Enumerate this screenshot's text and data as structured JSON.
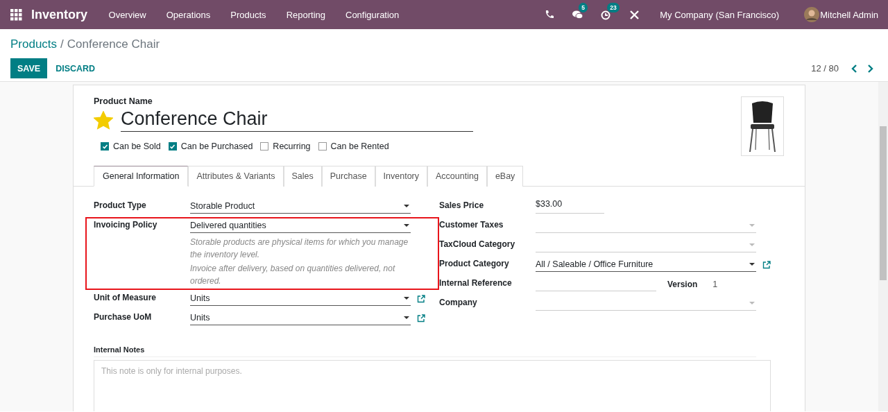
{
  "navbar": {
    "app_name": "Inventory",
    "menu": [
      "Overview",
      "Operations",
      "Products",
      "Reporting",
      "Configuration"
    ],
    "notifications": [
      {
        "kind": "phone"
      },
      {
        "kind": "messages",
        "count": "5"
      },
      {
        "kind": "activities",
        "count": "23"
      },
      {
        "kind": "debug"
      }
    ],
    "company": "My Company (San Francisco)",
    "user": "Mitchell Admin"
  },
  "breadcrumb": {
    "parent": "Products",
    "separator": "/",
    "current": "Conference Chair"
  },
  "buttons": [
    {
      "label": "SAVE",
      "kind": "primary"
    },
    {
      "label": "DISCARD",
      "kind": "link"
    }
  ],
  "pager": "12 / 80",
  "form": {
    "name_label": "Product Name",
    "name": "Conference Chair",
    "favorite": true,
    "options": [
      {
        "label": "Can be Sold",
        "checked": true
      },
      {
        "label": "Can be Purchased",
        "checked": true
      },
      {
        "label": "Recurring",
        "checked": false
      },
      {
        "label": "Can be Rented",
        "checked": false
      }
    ],
    "tabs": [
      {
        "label": "General Information",
        "selected": true
      },
      {
        "label": "Attributes & Variants",
        "selected": false
      },
      {
        "label": "Sales",
        "selected": false
      },
      {
        "label": "Purchase",
        "selected": false
      },
      {
        "label": "Inventory",
        "selected": false
      },
      {
        "label": "Accounting",
        "selected": false
      },
      {
        "label": "eBay",
        "selected": false
      }
    ],
    "left_fields": [
      {
        "label": "Product Type",
        "kind": "select",
        "value": "Storable Product",
        "link": false
      },
      {
        "label": "Invoicing Policy",
        "kind": "select",
        "value": "Delivered quantities",
        "link": false,
        "highlighted": true,
        "help": [
          "Storable products are physical items for which you manage the inventory level.",
          "Invoice after delivery, based on quantities delivered, not ordered."
        ]
      },
      {
        "label": "Unit of Measure",
        "kind": "select",
        "value": "Units",
        "link": true
      },
      {
        "label": "Purchase UoM",
        "kind": "select",
        "value": "Units",
        "link": true
      }
    ],
    "right_fields": [
      {
        "label": "Sales Price",
        "kind": "input",
        "value": "$33.00"
      },
      {
        "label": "Customer Taxes",
        "kind": "select",
        "link": false
      },
      {
        "label": "TaxCloud Category",
        "kind": "select",
        "link": false
      },
      {
        "label": "Product Category",
        "kind": "select",
        "value": "All / Saleable / Office Furniture",
        "link": true
      },
      {
        "label": "Internal Reference",
        "kind": "input",
        "extra": {
          "label": "Version",
          "value": "1"
        }
      },
      {
        "label": "Company",
        "kind": "select",
        "link": false
      }
    ],
    "notes": {
      "label": "Internal Notes",
      "placeholder": "This note is only for internal purposes."
    }
  }
}
